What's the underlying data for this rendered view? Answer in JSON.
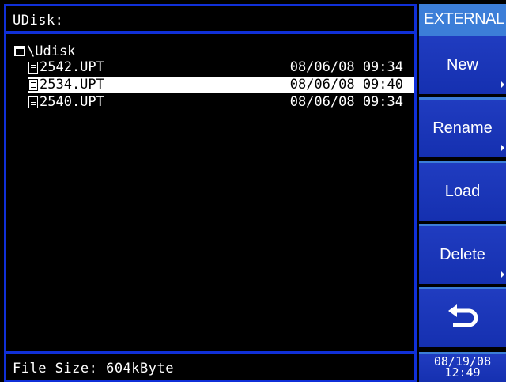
{
  "title_bar": {
    "label": "UDisk:"
  },
  "tree": {
    "root_label": "\\Udisk",
    "files": [
      {
        "name": "2542.UPT",
        "date": "08/06/08 09:34",
        "selected": false
      },
      {
        "name": "2534.UPT",
        "date": "08/06/08 09:40",
        "selected": true
      },
      {
        "name": "2540.UPT",
        "date": "08/06/08 09:34",
        "selected": false
      }
    ]
  },
  "status_bar": {
    "text": "File Size: 604kByte"
  },
  "side_menu": {
    "header": "EXTERNAL",
    "buttons": [
      {
        "label": "New",
        "has_submenu": true
      },
      {
        "label": "Rename",
        "has_submenu": true
      },
      {
        "label": "Load",
        "has_submenu": false
      },
      {
        "label": "Delete",
        "has_submenu": true
      }
    ],
    "back_icon": "return-arrow-icon",
    "date": "08/19/08",
    "time": "12:49"
  },
  "colors": {
    "frame": "#1030d8",
    "header_bg": "#3c7ed8",
    "button_bg": "#1a34b8",
    "selection": "#ffffff"
  }
}
